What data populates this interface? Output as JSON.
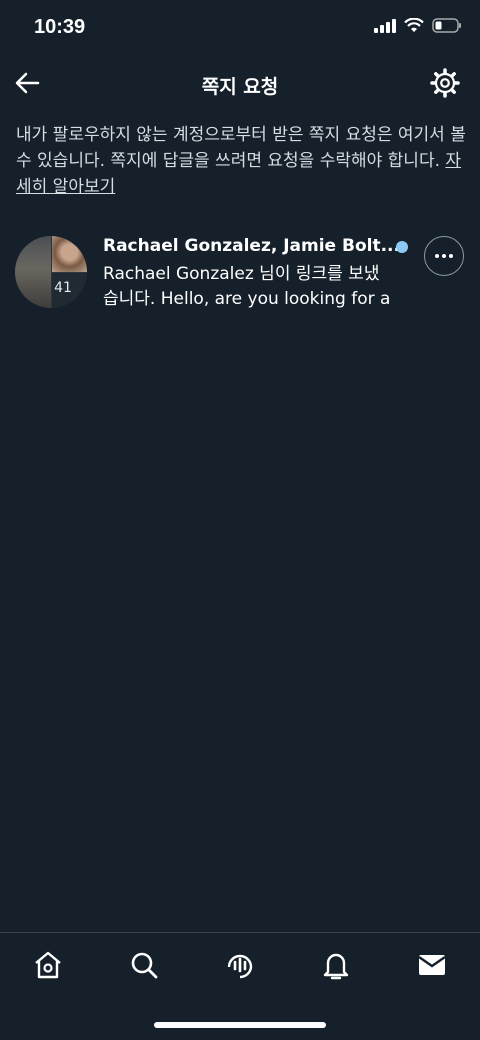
{
  "status": {
    "time": "10:39"
  },
  "header": {
    "title": "쪽지 요청"
  },
  "description": {
    "text": "내가 팔로우하지 않는 계정으로부터 받은 쪽지 요청은 여기서 볼 수 있습니다. 쪽지에 답글을 쓰려면 요청을 수락해야 합니다.",
    "link": "자세히 알아보기"
  },
  "conversation": {
    "names": "Rachael Gonzalez, Jamie Bolt...",
    "message": "Rachael Gonzalez 님이 링크를 보냈습니다. Hello, are you looking for a",
    "participant_count": "41",
    "unread_color": "#8ec8f6"
  },
  "tabs": [
    "home-icon",
    "search-icon",
    "spaces-icon",
    "notifications-icon",
    "messages-icon"
  ]
}
